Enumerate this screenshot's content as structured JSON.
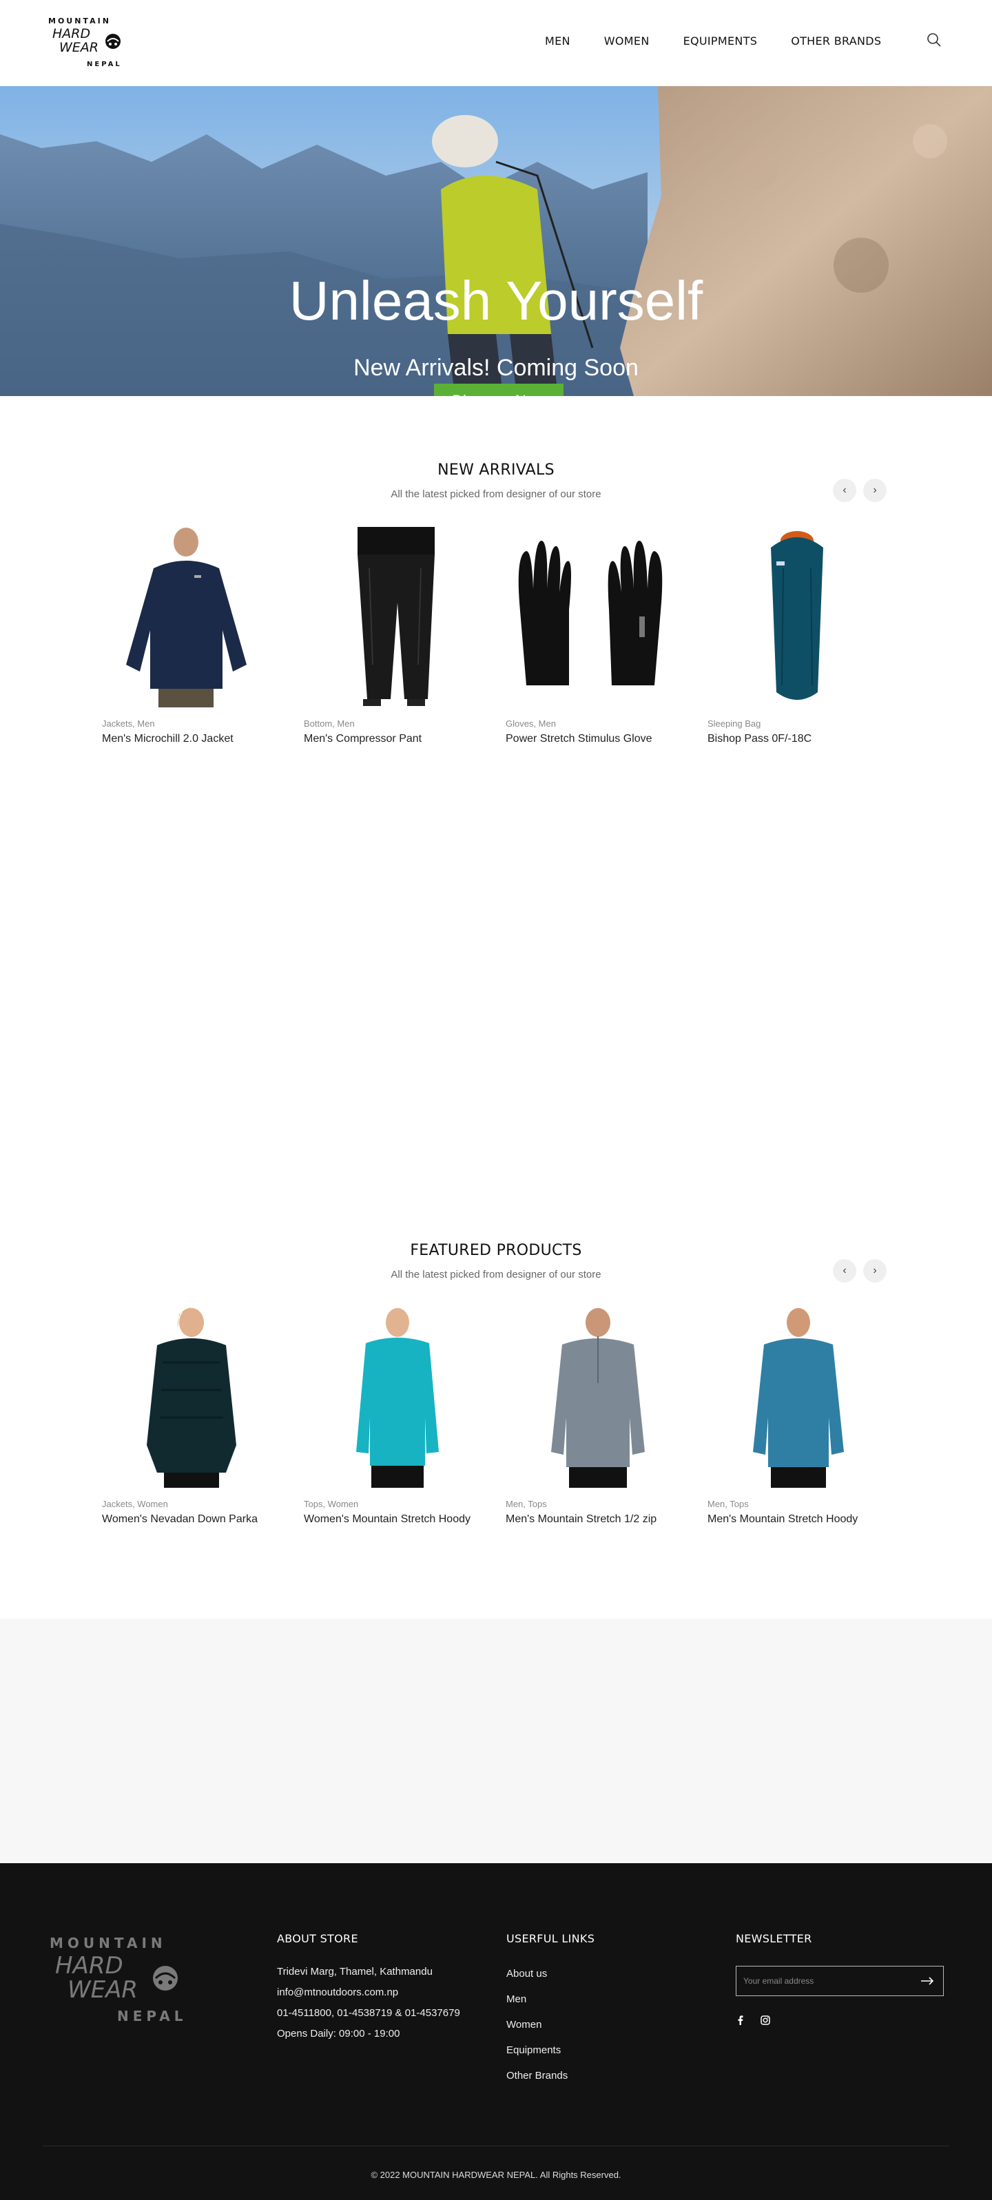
{
  "brand": {
    "logo_lines": [
      "MOUNTAIN",
      "HARD",
      "WEAR",
      "NEPAL"
    ]
  },
  "nav": {
    "items": [
      "MEN",
      "WOMEN",
      "EQUIPMENTS",
      "OTHER BRANDS"
    ],
    "search_icon": "search-icon"
  },
  "hero": {
    "title": "Unleash Yourself",
    "subtitle": "New Arrivals! Coming Soon",
    "button": "Discover Now"
  },
  "new_arrivals": {
    "title": "NEW ARRIVALS",
    "subtitle": "All the latest picked from designer of our store",
    "prev_icon": "chevron-left-icon",
    "next_icon": "chevron-right-icon",
    "products": [
      {
        "cats": "Jackets, Men",
        "name": "Men's Microchill 2.0 Jacket"
      },
      {
        "cats": "Bottom, Men",
        "name": "Men's Compressor Pant"
      },
      {
        "cats": "Gloves, Men",
        "name": "Power Stretch Stimulus Glove"
      },
      {
        "cats": "Sleeping Bag",
        "name": "Bishop Pass 0F/-18C"
      }
    ]
  },
  "featured": {
    "title": "FEATURED PRODUCTS",
    "subtitle": "All the latest picked from designer of our store",
    "prev_icon": "chevron-left-icon",
    "next_icon": "chevron-right-icon",
    "products": [
      {
        "cats": "Jackets, Women",
        "name": "Women's Nevadan Down Parka"
      },
      {
        "cats": "Tops, Women",
        "name": "Women's Mountain Stretch Hoody"
      },
      {
        "cats": "Men, Tops",
        "name": "Men's Mountain Stretch 1/2 zip"
      },
      {
        "cats": "Men, Tops",
        "name": "Men's Mountain Stretch Hoody"
      }
    ]
  },
  "footer": {
    "about": {
      "title": "ABOUT STORE",
      "address": "Tridevi Marg, Thamel, Kathmandu",
      "email": "info@mtnoutdoors.com.np",
      "phone": "01-4511800, 01-4538719 & 01-4537679",
      "hours": "Opens Daily: 09:00 - 19:00"
    },
    "links": {
      "title": "USERFUL LINKS",
      "items": [
        "About us",
        "Men",
        "Women",
        "Equipments",
        "Other Brands"
      ]
    },
    "newsletter": {
      "title": "NEWSLETTER",
      "placeholder": "Your email address",
      "submit_icon": "arrow-right-icon",
      "social_icons": [
        "facebook-icon",
        "instagram-icon"
      ]
    },
    "copyright": "© 2022 MOUNTAIN HARDWEAR NEPAL. All Rights Reserved."
  },
  "colors": {
    "accent_green": "#5bb135",
    "footer_bg": "#121212",
    "band_bg": "#f7f7f7"
  }
}
